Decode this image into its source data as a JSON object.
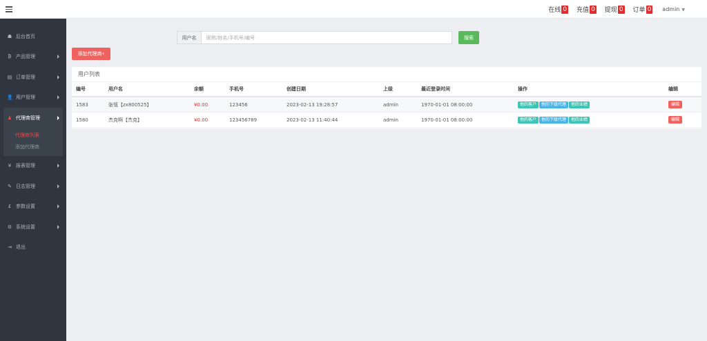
{
  "topbar": {
    "items": [
      {
        "label": "在线",
        "count": "0"
      },
      {
        "label": "充值",
        "count": "0"
      },
      {
        "label": "提现",
        "count": "0"
      },
      {
        "label": "订单",
        "count": "0"
      }
    ],
    "user": "admin"
  },
  "sidebar": {
    "items": [
      {
        "icon": "☗",
        "label": "后台首页"
      },
      {
        "icon": "₿",
        "label": "产品管理"
      },
      {
        "icon": "▤",
        "label": "订单管理"
      },
      {
        "icon": "👤",
        "label": "用户管理"
      },
      {
        "icon": "♟",
        "label": "代理商管理"
      },
      {
        "icon": "¥",
        "label": "报表管理"
      },
      {
        "icon": "✎",
        "label": "日志管理"
      },
      {
        "icon": "£",
        "label": "参数设置"
      },
      {
        "icon": "⚙",
        "label": "系统设置"
      },
      {
        "icon": "⇥",
        "label": "退出"
      }
    ],
    "submenu": [
      "代理商列表",
      "添加代理商"
    ]
  },
  "search": {
    "label": "用户名",
    "placeholder": "昵称/姓名/手机号/编号",
    "button": "搜索"
  },
  "add_button": "添加代理商+",
  "panel_title": "用户列表",
  "table": {
    "headers": [
      "编号",
      "用户名",
      "余额",
      "手机号",
      "创建日期",
      "上级",
      "最近登录时间",
      "操作",
      "编辑"
    ],
    "rows": [
      {
        "id": "1583",
        "name": "张瓴【zx800525】",
        "balance": "¥0.00",
        "phone": "123456",
        "created": "2023-02-13 19:28:57",
        "parent": "admin",
        "last_login": "1970-01-01 08:00:00"
      },
      {
        "id": "1580",
        "name": "杰克啊【杰克】",
        "balance": "¥0.00",
        "phone": "123456789",
        "created": "2023-02-13 11:40:44",
        "parent": "admin",
        "last_login": "1970-01-01 08:00:00"
      }
    ],
    "ops": [
      "他的客户",
      "他的下级代理",
      "他的业绩"
    ],
    "edit": "编辑"
  }
}
